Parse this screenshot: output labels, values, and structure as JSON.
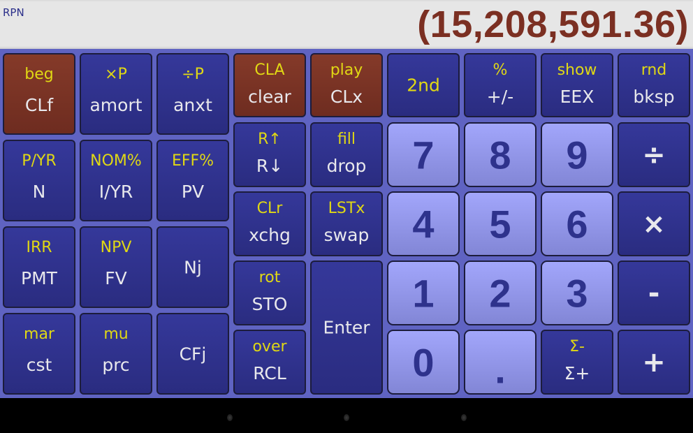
{
  "display": {
    "mode": "RPN",
    "value": "(15,208,591.36)",
    "value_color": "#7b2f22"
  },
  "keys": {
    "left": [
      {
        "id": "clf",
        "top": "beg",
        "main": "CLf",
        "style": "red"
      },
      {
        "id": "amort",
        "top": "×P",
        "main": "amort",
        "style": "blue"
      },
      {
        "id": "anxt",
        "top": "÷P",
        "main": "anxt",
        "style": "blue"
      },
      {
        "id": "n",
        "top": "P/YR",
        "main": "N",
        "style": "blue"
      },
      {
        "id": "i-yr",
        "top": "NOM%",
        "main": "I/YR",
        "style": "blue"
      },
      {
        "id": "pv",
        "top": "EFF%",
        "main": "PV",
        "style": "blue"
      },
      {
        "id": "pmt",
        "top": "IRR",
        "main": "PMT",
        "style": "blue"
      },
      {
        "id": "fv",
        "top": "NPV",
        "main": "FV",
        "style": "blue"
      },
      {
        "id": "nj",
        "top": "",
        "main": "Nj",
        "style": "blue"
      },
      {
        "id": "cst",
        "top": "mar",
        "main": "cst",
        "style": "blue"
      },
      {
        "id": "prc",
        "top": "mu",
        "main": "prc",
        "style": "blue"
      },
      {
        "id": "cfj",
        "top": "",
        "main": "CFj",
        "style": "blue"
      }
    ],
    "clear": {
      "top": "CLA",
      "main": "clear"
    },
    "clx": {
      "top": "play",
      "main": "CLx"
    },
    "second": {
      "main": "2nd"
    },
    "sign": {
      "top": "%",
      "main": "+/-"
    },
    "eex": {
      "top": "show",
      "main": "EEX"
    },
    "bksp": {
      "top": "rnd",
      "main": "bksp"
    },
    "rdown": {
      "top": "R↑",
      "main": "R↓"
    },
    "drop": {
      "top": "fill",
      "main": "drop"
    },
    "xchg": {
      "top": "CLr",
      "main": "xchg"
    },
    "swap": {
      "top": "LSTx",
      "main": "swap"
    },
    "sto": {
      "top": "rot",
      "main": "STO"
    },
    "rcl": {
      "top": "over",
      "main": "RCL"
    },
    "enter": {
      "main": "Enter"
    },
    "digits": {
      "d7": "7",
      "d8": "8",
      "d9": "9",
      "d4": "4",
      "d5": "5",
      "d6": "6",
      "d1": "1",
      "d2": "2",
      "d3": "3",
      "d0": "0",
      "dot": "."
    },
    "ops": {
      "divide": "÷",
      "multiply": "×",
      "subtract": "-",
      "add": "+"
    },
    "sigma": {
      "top": "Σ-",
      "main": "Σ+"
    }
  },
  "colors": {
    "keypad_bg": "#5f63c2",
    "key_blue": "#2f3290",
    "key_red": "#7a3324",
    "key_digit": "#9296ea",
    "shift_label": "#e0d814"
  }
}
